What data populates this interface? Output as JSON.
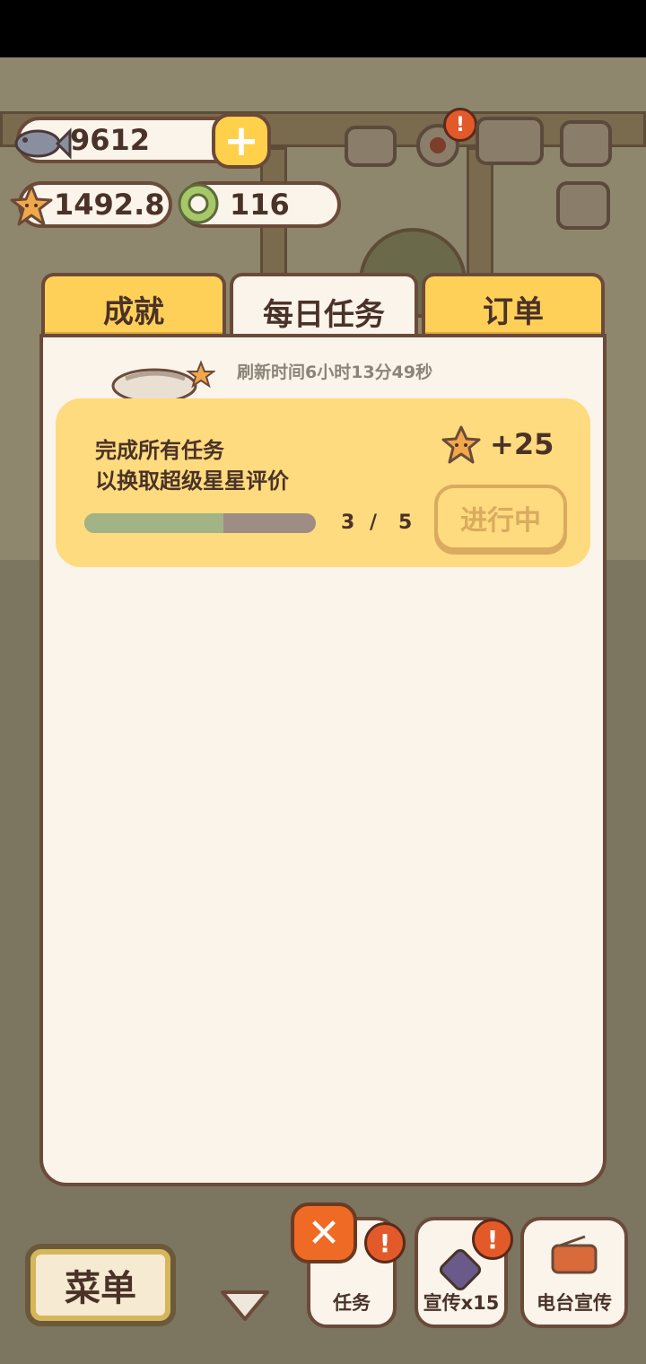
{
  "hud": {
    "fish_count": "9612",
    "star_count": "1492.8",
    "coin_count": "116",
    "plus_label": "+",
    "alert_mark": "!"
  },
  "tabs": [
    {
      "label": "成就",
      "active": false
    },
    {
      "label": "每日任务",
      "active": true
    },
    {
      "label": "订单",
      "active": false
    }
  ],
  "daily": {
    "refresh_text": "刷新时间6小时13分49秒",
    "task_line1": "完成所有任务",
    "task_line2": "以换取超级星星评价",
    "reward": "+25",
    "progress_current": "3",
    "progress_sep": "/",
    "progress_total": "5",
    "progress_fraction": 0.6,
    "status_label": "进行中"
  },
  "bottom": {
    "menu_label": "菜单",
    "close_label": "✕",
    "task_label": "任务",
    "promo_label": "宣传x15",
    "radio_label": "电台宣传"
  },
  "colors": {
    "tab_active": "#fbf4ea",
    "tab_inactive": "#ffd057",
    "card": "#fedb7e",
    "progress_fill": "#a2b386",
    "close": "#ef6a24"
  }
}
